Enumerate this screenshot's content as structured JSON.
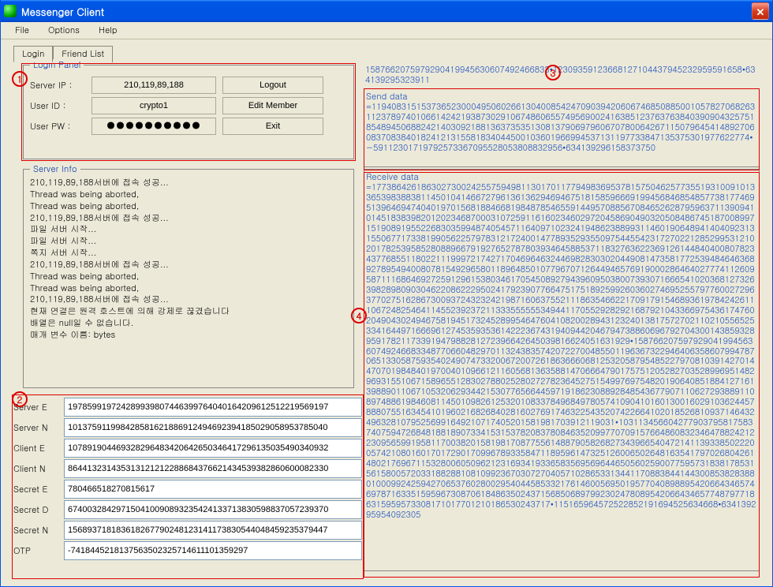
{
  "window": {
    "title": "Messenger Client"
  },
  "menu": {
    "file": "File",
    "options": "Options",
    "help": "Help"
  },
  "tabs": {
    "login": "Login",
    "friend": "Friend List"
  },
  "login": {
    "legend": "Login Panel",
    "labels": {
      "serverip": "Server IP :",
      "userid": "User ID :",
      "userpw": "User PW :"
    },
    "values": {
      "serverip": "210,119,89,188",
      "userid": "crypto1",
      "userpw": "●●●●●●●●●●"
    },
    "buttons": {
      "logout": "Logout",
      "edit": "Edit Member",
      "exit": "Exit"
    }
  },
  "serverinfo": {
    "legend": "Server Info",
    "text": "210,119,89,188서버에 접속 성공...\nThread was being aborted,\nThread was being aborted,\n210,119,89,188서버에 접속 성공...\n파일 서버 시작...\n파일 서버 시작...\n쪽지 서버 시작...\n210,119,89,188서버에 접속 성공...\nThread was being aborted,\nThread was being aborted,\n210,119,89,188서버에 접속 성공...\n현재 연결은 원격 호스트에 의해 강제로 끊겼습니다\n배열은 null일 수 없습니다.\n매개 변수 이름: bytes"
  },
  "keys": {
    "labels": [
      "Server E",
      "Server N",
      "Client E",
      "Client N",
      "Secret E",
      "Secret D",
      "Secret N",
      "OTP"
    ],
    "values": [
      "197859919724289939807446399764040164209612512219569197",
      "101375911998428581621886912494692394185029058953785040",
      "107891904469328296483420642650346417296135035490340932",
      "864413231435313121212288684376621434539382860600082330",
      "780466518270815617",
      "674003284297150410090893235424133713830598837057239370",
      "156893718183618267790248123141173830544048459235379447",
      "-7418445218137563502325714611101359297"
    ]
  },
  "header_numbers": "1587662075979290419945630607492466833•12309359123668127104437945232959591658•634139295323911",
  "send": {
    "title": "Send data",
    "body": "=1194083151537365230004950602661304008542470903942060674685088500105782706826311237897401066142421938730291067486065574956900241638512376376384039090432575185489450688242140309218813637353513081379069796067078006426711507964541489270608370838401824121315581834044500103601966994537131197733847135375301977622774•−59112301719792573367095528053808832956•634139296158373750"
  },
  "receive": {
    "title": "Receive data",
    "body": "=1773864261863027300242557594981130170117794983695378157504625773551931009101336539838838114501041466727961361362946946751815859666919945684685485773817746951396469474040197015681884668198487854655914495708856708465262879596371139094101451838398201202346870003107259116160234602972045869049032050848674518700899715190891955226830359948740545711640971023241948623889931146019064894140409231315506771733819905622579783121724001477893529355097544554231727022128529953121020178253958528088966791927652787803934645885371183276362236912614484040080782343776855118022111999721742717046964632446982830302044908147358177253948464636892789549400807815492965801189648501077967071264494657691900028646402777411260958711168646927259129615380346170545089279439609503800739307166654102036812732639828980903046220862229502417923907766475175189259926036027469525579776002729637702751628673009372432324219871606375521118635466221709179154689361978424261110672482546411455239237211333555555349441170552928292168792104336697543617476020490430249467581945173245289954647604108200289431232401381757270211021055652533416449716669612745359353614222367431940944204679473886069679270430014385932895917821173391947988281272396642645039816624051631929•15876620759792904199456360749246683348770660482970113243835742072270048550119636732294640635860799478706513305875935402490747332006720072618636660681253205879548522797081039142701447070198484019700401096612116056813635881470666479017575120528270352899695148296931551067158965512830278802528027278236452751549976975482019064085188412716139889011067105320629344215307765664459719186230889284854367790711062729388911089748861984608114501098261253201083378496849780574109041016013001602910362445788807551634541019602168268402816027691746322543520742266410201852681093714643249632810795256991649210717405201581981703912119031•1031134566042779037958175837407594726848188189073341531537820837808463520997707091576648608323464788242122309565991958117003820158198170877556148879058268273439665404721411393385022200574210801601701729017099678933584711895961473251260065026481635417970268042614802176967115328006050962123169341933658356956964465056025900775957318381785315615800572033188288108109923670307270405710286533134411708838441443008538283880100099242594270653760280029540445853321761460056950195770408988954206643465746978716335159596730870618486350243715685068979923024780895420664346577487977186315959573308171017701210186530243717•115165964572522852191694525634668•634139295954092305"
  },
  "annotations": {
    "c1": "1",
    "c2": "2",
    "c3": "3",
    "c4": "4"
  }
}
